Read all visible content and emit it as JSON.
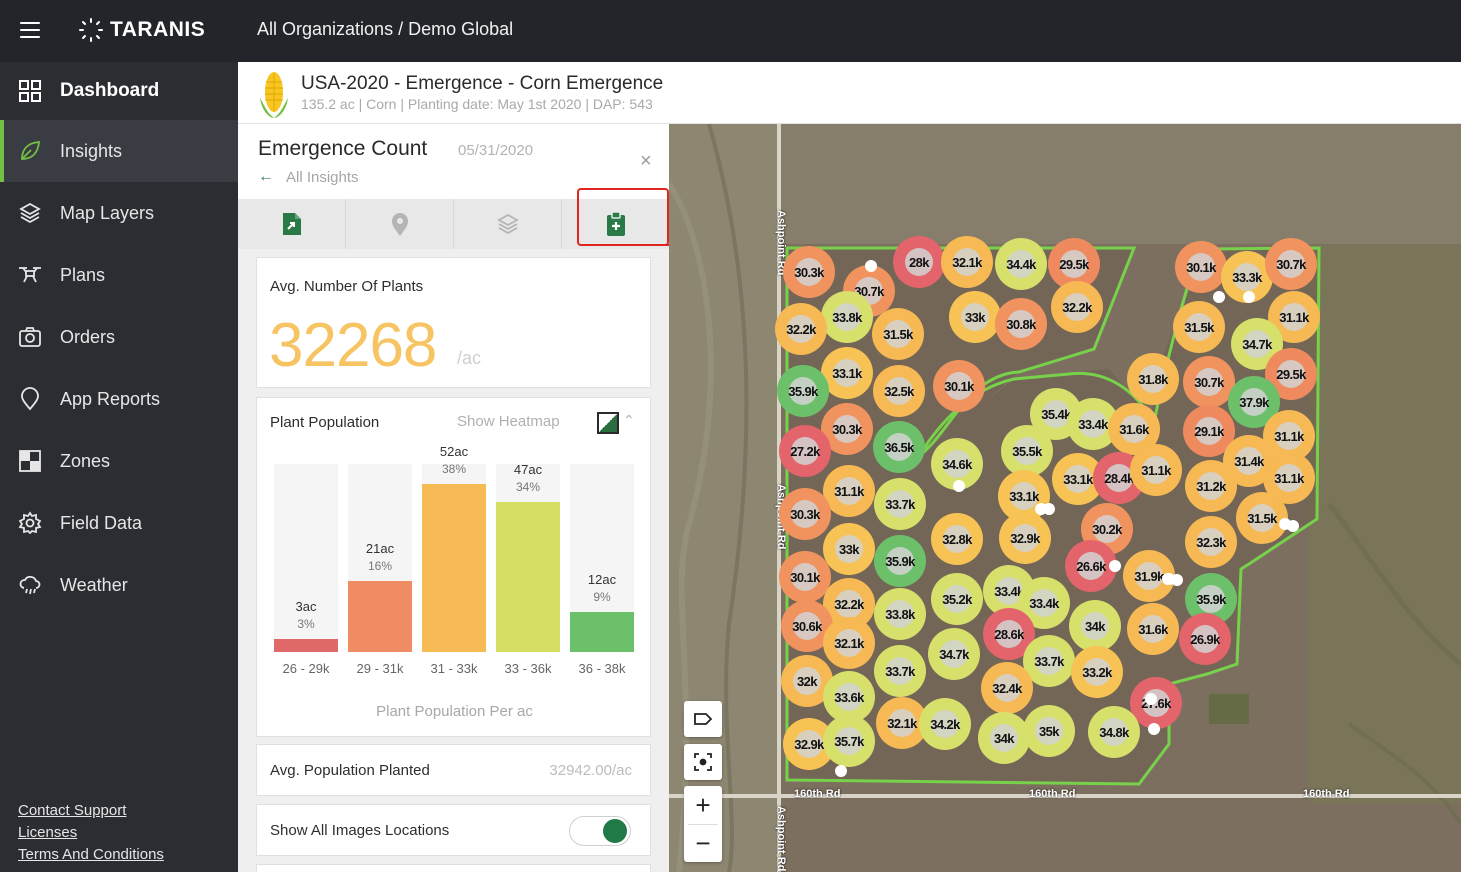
{
  "topbar": {
    "logo_text": "TARANIS",
    "breadcrumb": "All Organizations / Demo Global"
  },
  "sidebar": {
    "items": [
      {
        "label": "Dashboard",
        "icon": "dashboard-grid-icon"
      },
      {
        "label": "Insights",
        "icon": "leaf-icon",
        "active": true
      },
      {
        "label": "Map Layers",
        "icon": "layers-icon"
      },
      {
        "label": "Plans",
        "icon": "drone-icon"
      },
      {
        "label": "Orders",
        "icon": "camera-icon"
      },
      {
        "label": "App Reports",
        "icon": "map-pin-icon"
      },
      {
        "label": "Zones",
        "icon": "zones-icon"
      },
      {
        "label": "Field Data",
        "icon": "gear-icon"
      },
      {
        "label": "Weather",
        "icon": "cloud-rain-icon"
      }
    ],
    "links": [
      "Contact Support",
      "Licenses",
      "Terms And Conditions"
    ]
  },
  "field": {
    "title": "USA-2020 - Emergence - Corn Emergence",
    "subtitle": "135.2 ac | Corn | Planting date: May 1st 2020 | DAP: 543"
  },
  "panel": {
    "title": "Emergence Count",
    "date": "05/31/2020",
    "back_label": "All Insights",
    "close_glyph": "×",
    "tabs": [
      "export-report-icon",
      "location-pin-icon",
      "layers-icon",
      "clipboard-plus-icon"
    ],
    "avg_plants": {
      "label": "Avg. Number Of Plants",
      "value": "32268",
      "unit": "/ac"
    },
    "population": {
      "label": "Plant Population",
      "heatmap_label": "Show Heatmap",
      "caption": "Plant Population Per ac"
    },
    "avg_planted": {
      "label": "Avg. Population Planted",
      "value": "32942.00/ac"
    },
    "images_toggle": {
      "label": "Show All Images Locations",
      "on": true
    }
  },
  "chart_data": {
    "type": "bar",
    "categories": [
      "26 - 29k",
      "29 - 31k",
      "31 - 33k",
      "33 - 36k",
      "36 - 38k"
    ],
    "series": [
      {
        "name": "ac",
        "values": [
          3,
          21,
          52,
          47,
          12
        ]
      },
      {
        "name": "percent",
        "values": [
          3,
          16,
          38,
          34,
          9
        ]
      }
    ],
    "ac_labels": [
      "3ac",
      "21ac",
      "52ac",
      "47ac",
      "12ac"
    ],
    "pct_labels": [
      "3%",
      "16%",
      "38%",
      "34%",
      "9%"
    ],
    "colors": [
      "#e06a6a",
      "#ef8c64",
      "#f7bb56",
      "#d7df63",
      "#6cc06a"
    ],
    "title": "",
    "xlabel": "Plant Population Per ac",
    "ylim": [
      0,
      100
    ]
  },
  "map": {
    "road_labels": [
      "Ashpoint Rd",
      "Ashpoint Rd",
      "Ashpoint Rd",
      "160th Rd",
      "160th Rd",
      "160th Rd"
    ],
    "markers": [
      {
        "v": "30.3k",
        "c": "#f0935f"
      },
      {
        "v": "28k",
        "c": "#e3646b"
      },
      {
        "v": "32.1k",
        "c": "#f7b954"
      },
      {
        "v": "34.4k",
        "c": "#d6e06a"
      },
      {
        "v": "29.5k",
        "c": "#ef8a5f"
      },
      {
        "v": "30.7k",
        "c": "#f0935f"
      },
      {
        "v": "33.8k",
        "c": "#d6e06a"
      },
      {
        "v": "33k",
        "c": "#f7c354"
      },
      {
        "v": "30.8k",
        "c": "#f0935f"
      },
      {
        "v": "32.2k",
        "c": "#f7b954"
      },
      {
        "v": "32.2k",
        "c": "#f7b954"
      },
      {
        "v": "31.5k",
        "c": "#f7b954"
      },
      {
        "v": "33.1k",
        "c": "#f7c354"
      },
      {
        "v": "35.9k",
        "c": "#6cc06a"
      },
      {
        "v": "32.5k",
        "c": "#f7b954"
      },
      {
        "v": "30.1k",
        "c": "#f0935f"
      },
      {
        "v": "30.3k",
        "c": "#f0935f"
      },
      {
        "v": "27.2k",
        "c": "#e3646b"
      },
      {
        "v": "36.5k",
        "c": "#6cc06a"
      },
      {
        "v": "34.6k",
        "c": "#d6e06a"
      },
      {
        "v": "31.1k",
        "c": "#f7b954"
      },
      {
        "v": "33.7k",
        "c": "#d6e06a"
      },
      {
        "v": "30.3k",
        "c": "#f0935f"
      },
      {
        "v": "33k",
        "c": "#f7c354"
      },
      {
        "v": "35.9k",
        "c": "#6cc06a"
      },
      {
        "v": "32.8k",
        "c": "#f7c354"
      },
      {
        "v": "30.1k",
        "c": "#f0935f"
      },
      {
        "v": "32.2k",
        "c": "#f7b954"
      },
      {
        "v": "30.6k",
        "c": "#f0935f"
      },
      {
        "v": "33.8k",
        "c": "#d6e06a"
      },
      {
        "v": "35.2k",
        "c": "#d6e06a"
      },
      {
        "v": "32.1k",
        "c": "#f7b954"
      },
      {
        "v": "32k",
        "c": "#f7b954"
      },
      {
        "v": "33.7k",
        "c": "#d6e06a"
      },
      {
        "v": "34.7k",
        "c": "#d6e06a"
      },
      {
        "v": "33.6k",
        "c": "#d6e06a"
      },
      {
        "v": "32.9k",
        "c": "#f7c354"
      },
      {
        "v": "35.7k",
        "c": "#d6e06a"
      },
      {
        "v": "32.1k",
        "c": "#f7b954"
      },
      {
        "v": "34.2k",
        "c": "#d6e06a"
      },
      {
        "v": "35.4k",
        "c": "#d6e06a"
      },
      {
        "v": "33.4k",
        "c": "#d6e06a"
      },
      {
        "v": "31.6k",
        "c": "#f7b954"
      },
      {
        "v": "35.5k",
        "c": "#d6e06a"
      },
      {
        "v": "33.1k",
        "c": "#f7c354"
      },
      {
        "v": "28.4k",
        "c": "#e3646b"
      },
      {
        "v": "31.1k",
        "c": "#f7b954"
      },
      {
        "v": "33.1k",
        "c": "#f7c354"
      },
      {
        "v": "30.2k",
        "c": "#f0935f"
      },
      {
        "v": "32.9k",
        "c": "#f7c354"
      },
      {
        "v": "26.6k",
        "c": "#e3646b"
      },
      {
        "v": "31.9k",
        "c": "#f7b954"
      },
      {
        "v": "33.4k",
        "c": "#d6e06a"
      },
      {
        "v": "33.4k",
        "c": "#d6e06a"
      },
      {
        "v": "28.6k",
        "c": "#e3646b"
      },
      {
        "v": "34k",
        "c": "#d6e06a"
      },
      {
        "v": "31.6k",
        "c": "#f7b954"
      },
      {
        "v": "33.7k",
        "c": "#d6e06a"
      },
      {
        "v": "33.2k",
        "c": "#f7c354"
      },
      {
        "v": "32.4k",
        "c": "#f7b954"
      },
      {
        "v": "27.6k",
        "c": "#e3646b"
      },
      {
        "v": "34k",
        "c": "#d6e06a"
      },
      {
        "v": "35k",
        "c": "#d6e06a"
      },
      {
        "v": "34.8k",
        "c": "#d6e06a"
      },
      {
        "v": "30.1k",
        "c": "#f0935f"
      },
      {
        "v": "33.3k",
        "c": "#f7c354"
      },
      {
        "v": "30.7k",
        "c": "#f0935f"
      },
      {
        "v": "31.5k",
        "c": "#f7b954"
      },
      {
        "v": "31.1k",
        "c": "#f7b954"
      },
      {
        "v": "34.7k",
        "c": "#d6e06a"
      },
      {
        "v": "31.8k",
        "c": "#f7b954"
      },
      {
        "v": "30.7k",
        "c": "#f0935f"
      },
      {
        "v": "29.5k",
        "c": "#ef8a5f"
      },
      {
        "v": "37.9k",
        "c": "#6cc06a"
      },
      {
        "v": "29.1k",
        "c": "#ef8a5f"
      },
      {
        "v": "31.1k",
        "c": "#f7b954"
      },
      {
        "v": "31.4k",
        "c": "#f7b954"
      },
      {
        "v": "31.2k",
        "c": "#f7b954"
      },
      {
        "v": "31.1k",
        "c": "#f7b954"
      },
      {
        "v": "31.5k",
        "c": "#f7b954"
      },
      {
        "v": "32.3k",
        "c": "#f7b954"
      },
      {
        "v": "35.9k",
        "c": "#6cc06a"
      },
      {
        "v": "26.9k",
        "c": "#e3646b"
      }
    ],
    "controls": [
      "tag-icon",
      "focus-icon"
    ],
    "zoom_in": "+",
    "zoom_out": "−"
  }
}
